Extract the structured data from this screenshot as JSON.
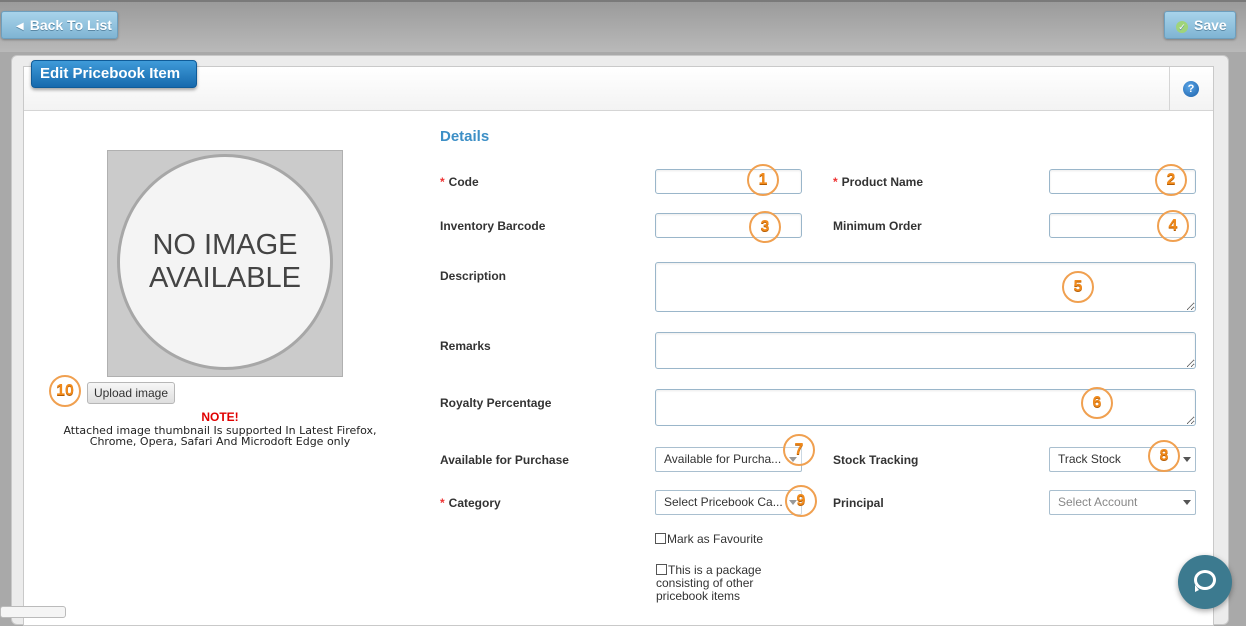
{
  "toolbar": {
    "back_label": "Back To List",
    "back_icon": "arrow-left-icon",
    "save_label": "Save",
    "save_icon": "check-icon"
  },
  "panel": {
    "title": "Edit Pricebook Item",
    "help_icon": "?"
  },
  "image": {
    "placeholder_text": "NO IMAGE\nAVAILABLE",
    "upload_label": "Upload image",
    "note_title": "NOTE!",
    "note_text": "Attached image thumbnail Is supported In Latest Firefox, Chrome, Opera, Safari And Microdoft Edge only"
  },
  "form": {
    "section_title": "Details",
    "code_label": "Code",
    "product_name_label": "Product Name",
    "inventory_barcode_label": "Inventory Barcode",
    "minimum_order_label": "Minimum Order",
    "description_label": "Description",
    "remarks_label": "Remarks",
    "royalty_label": "Royalty Percentage",
    "available_label": "Available for Purchase",
    "available_value": "Available for Purcha...",
    "stock_label": "Stock Tracking",
    "stock_value": "Track Stock",
    "category_label": "Category",
    "category_placeholder": "Select Pricebook Ca...",
    "principal_label": "Principal",
    "principal_placeholder": "Select Account",
    "favourite_label": "Mark as Favourite",
    "package_label": "This is a package\nconsisting of other\npricebook items",
    "required_mark": "*"
  },
  "annotations": [
    "1",
    "2",
    "3",
    "4",
    "5",
    "6",
    "7",
    "8",
    "9",
    "10"
  ],
  "colors": {
    "accent": "#3d8fc6",
    "badge": "#f08a1c",
    "required": "#e33333",
    "note": "#e00000"
  }
}
